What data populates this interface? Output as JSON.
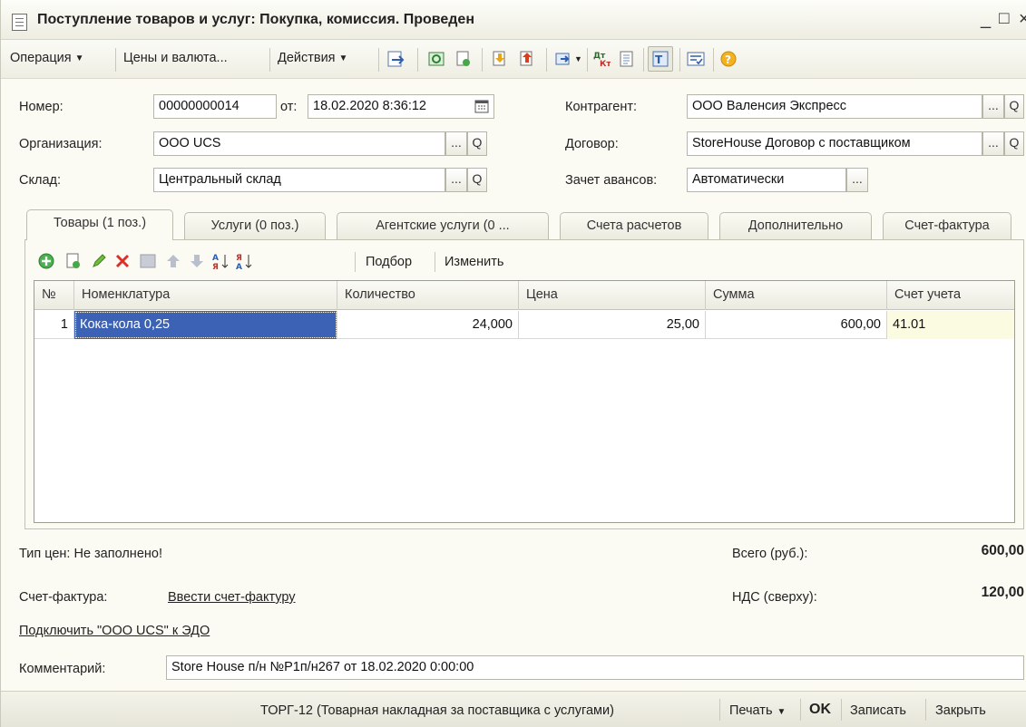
{
  "window": {
    "title": "Поступление товаров и услуг: Покупка, комиссия. Проведен",
    "minimize": "_",
    "maximize": "□",
    "close": "×"
  },
  "toolbar": {
    "operation": "Операция",
    "prices_currency": "Цены и валюта...",
    "actions": "Действия",
    "icons": [
      "post-icon",
      "structure-icon",
      "copy-icon",
      "import-icon",
      "export-icon",
      "goto-icon",
      "dt-kt-icon",
      "journal-icon",
      "text-icon",
      "checklist-icon",
      "help-icon"
    ]
  },
  "header": {
    "number_label": "Номер:",
    "number_value": "00000000014",
    "date_label": "от:",
    "date_value": "18.02.2020  8:36:12",
    "org_label": "Организация:",
    "org_value": "ООО UCS",
    "warehouse_label": "Склад:",
    "warehouse_value": "Центральный склад",
    "counterparty_label": "Контрагент:",
    "counterparty_value": "ООО Валенсия Экспресс",
    "contract_label": "Договор:",
    "contract_value": "StoreHouse Договор с поставщиком",
    "advance_label": "Зачет авансов:",
    "advance_value": "Автоматически",
    "select_btn": "...",
    "open_btn": "Q"
  },
  "tabs": [
    {
      "label": "Товары (1 поз.)",
      "active": true
    },
    {
      "label": "Услуги (0 поз.)",
      "active": false
    },
    {
      "label": "Агентские услуги (0 ...",
      "active": false
    },
    {
      "label": "Счета расчетов",
      "active": false
    },
    {
      "label": "Дополнительно",
      "active": false
    },
    {
      "label": "Счет-фактура",
      "active": false
    }
  ],
  "table_toolbar": {
    "selection": "Подбор",
    "change": "Изменить"
  },
  "table": {
    "columns": [
      "№",
      "Номенклатура",
      "Количество",
      "Цена",
      "Сумма",
      "Счет учета"
    ],
    "rows": [
      {
        "n": "1",
        "item": "Кока-кола 0,25",
        "qty": "24,000",
        "price": "25,00",
        "sum": "600,00",
        "account": "41.01"
      }
    ]
  },
  "footer": {
    "price_type": "Тип цен: Не заполнено!",
    "invoice_label": "Счет-фактура:",
    "invoice_link": "Ввести счет-фактуру",
    "edo_link": "Подключить \"ООО UCS\" к ЭДО",
    "total_label": "Всего (руб.):",
    "total_value": "600,00",
    "vat_label": "НДС (сверху):",
    "vat_value": "120,00",
    "comment_label": "Комментарий:",
    "comment_value": "Store House п/н №P1п/н267 от 18.02.2020 0:00:00"
  },
  "bottom": {
    "torg12": "ТОРГ-12 (Товарная накладная за поставщика с услугами)",
    "print": "Печать",
    "ok": "OK",
    "save": "Записать",
    "close": "Закрыть"
  }
}
